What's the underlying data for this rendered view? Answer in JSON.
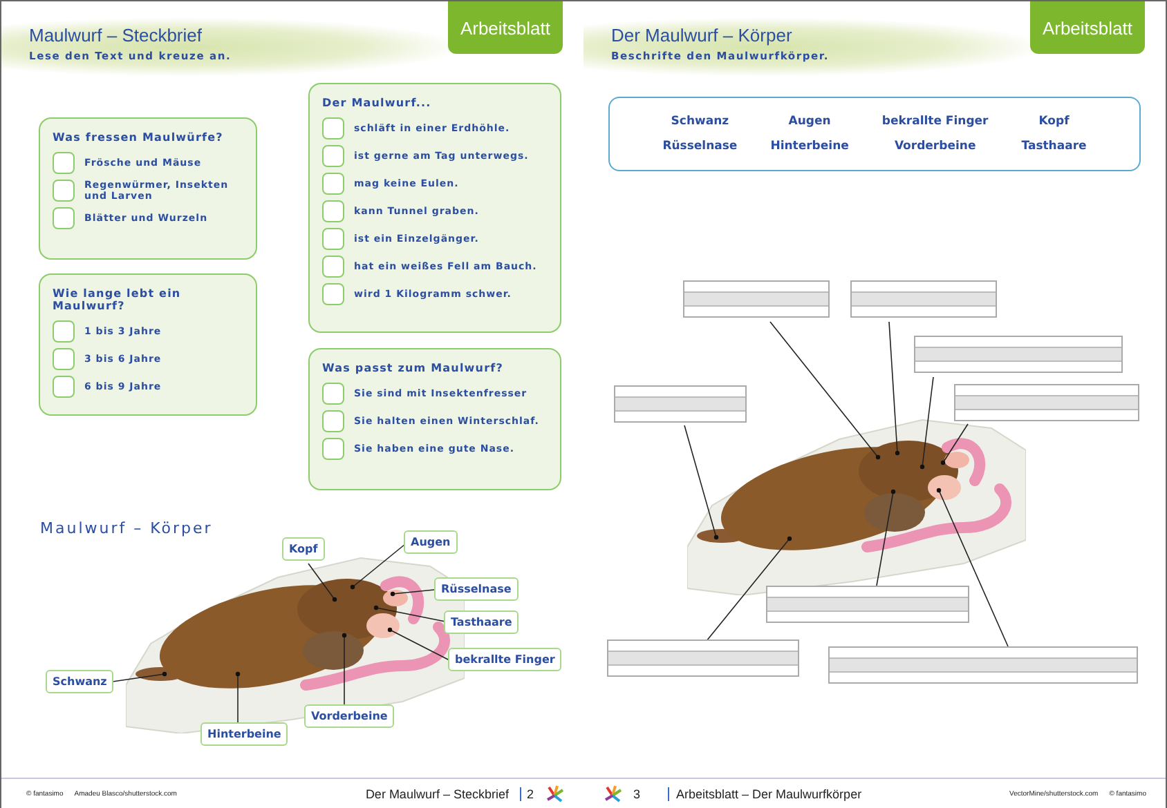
{
  "left_page": {
    "header": {
      "title": "Maulwurf – Steckbrief",
      "subtitle": "Lese den Text und kreuze an.",
      "tab": "Arbeitsblatt"
    },
    "cards_left": [
      {
        "title": "Was fressen Maulwürfe?",
        "options": [
          {
            "text": "Frösche und Mäuse",
            "checked": false
          },
          {
            "text": "Regenwürmer, Insekten und Larven",
            "checked": false
          },
          {
            "text": "Blätter und Wurzeln",
            "checked": false
          }
        ]
      },
      {
        "title": "Wie lange lebt ein Maulwurf?",
        "options": [
          {
            "text": "1 bis 3 Jahre",
            "checked": false
          },
          {
            "text": "3 bis 6 Jahre",
            "checked": false
          },
          {
            "text": "6 bis 9 Jahre",
            "checked": false
          }
        ]
      }
    ],
    "cards_right": [
      {
        "title": "Der Maulwurf...",
        "options": [
          {
            "text": "schläft in einer Erdhöhle.",
            "checked": false
          },
          {
            "text": "ist gerne am Tag unterwegs.",
            "checked": false
          },
          {
            "text": "mag keine Eulen.",
            "checked": false
          },
          {
            "text": "kann Tunnel graben.",
            "checked": false
          },
          {
            "text": "ist ein Einzelgänger.",
            "checked": false
          },
          {
            "text": "hat ein weißes Fell am Bauch.",
            "checked": false
          },
          {
            "text": "wird 1 Kilogramm schwer.",
            "checked": false
          }
        ]
      },
      {
        "title": "Was passt zum Maulwurf?",
        "options": [
          {
            "text": "Sie sind mit Insektenfresser",
            "checked": false
          },
          {
            "text": "Sie halten einen Winterschlaf.",
            "checked": false
          },
          {
            "text": "Sie haben eine gute Nase.",
            "checked": false
          }
        ]
      }
    ],
    "diagram": {
      "title": "Maulwurf – Körper",
      "labels": [
        "Kopf",
        "Augen",
        "Rüsselnase",
        "Tasthaare",
        "bekrallte Finger",
        "Schwanz",
        "Hinterbeine",
        "Vorderbeine"
      ]
    },
    "footer": {
      "copyright": "© fantasimo",
      "credit": "Amadeu Blasco/shutterstock.com",
      "page_title": "Der Maulwurf – Steckbrief",
      "page_number": "2"
    }
  },
  "right_page": {
    "header": {
      "title": "Der Maulwurf – Körper",
      "subtitle": "Beschrifte den Maulwurfkörper.",
      "tab": "Arbeitsblatt"
    },
    "word_bank": [
      "Schwanz",
      "Augen",
      "bekrallte Finger",
      "Kopf",
      "Rüsselnase",
      "Hinterbeine",
      "Vorderbeine",
      "Tasthaare"
    ],
    "footer": {
      "page_number": "3",
      "page_title": "Arbeitsblatt – Der Maulwurfkörper",
      "credit": "VectorMine/shutterstock.com",
      "copyright": "© fantasimo"
    }
  }
}
